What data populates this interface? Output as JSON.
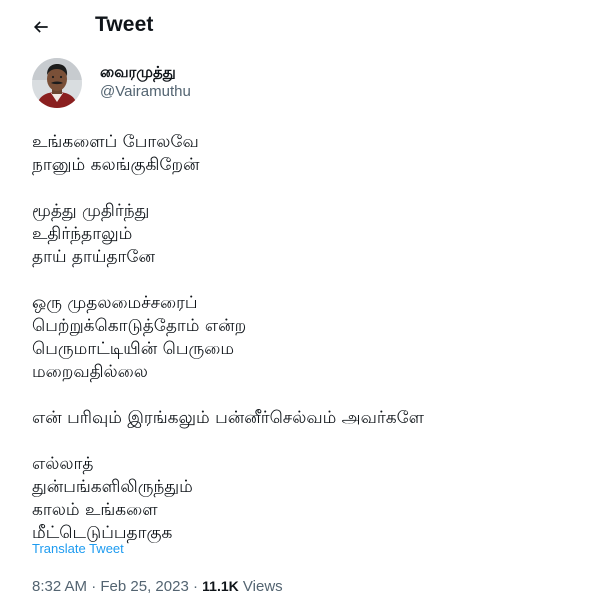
{
  "header": {
    "back_icon": "arrow-left-icon",
    "title": "Tweet"
  },
  "author": {
    "display_name": "வைரமுத்து",
    "handle": "@Vairamuthu"
  },
  "tweet": {
    "stanzas": [
      [
        "உங்களைப் போலவே",
        "நானும் கலங்குகிறேன்"
      ],
      [
        "மூத்து முதிர்ந்து",
        "உதிர்ந்தாலும்",
        "தாய் தாய்தானே"
      ],
      [
        "ஒரு முதலமைச்சரைப்",
        "பெற்றுக்கொடுத்தோம் என்ற",
        "பெருமாட்டியின் பெருமை",
        "மறைவதில்லை"
      ],
      [
        "என் பரிவும் இரங்கலும் பன்னீர்செல்வம் அவர்களே"
      ],
      [
        "எல்லாத்",
        "துன்பங்களிலிருந்தும்",
        "காலம் உங்களை",
        "மீட்டெடுப்பதாகுக"
      ]
    ],
    "translate_label": "Translate Tweet"
  },
  "meta": {
    "time": "8:32 AM",
    "separator": "·",
    "date": "Feb 25, 2023",
    "views_count": "11.1K",
    "views_label": "Views"
  },
  "colors": {
    "link": "#1d9bf0",
    "secondary_text": "#536471",
    "primary_text": "#0f1419"
  }
}
